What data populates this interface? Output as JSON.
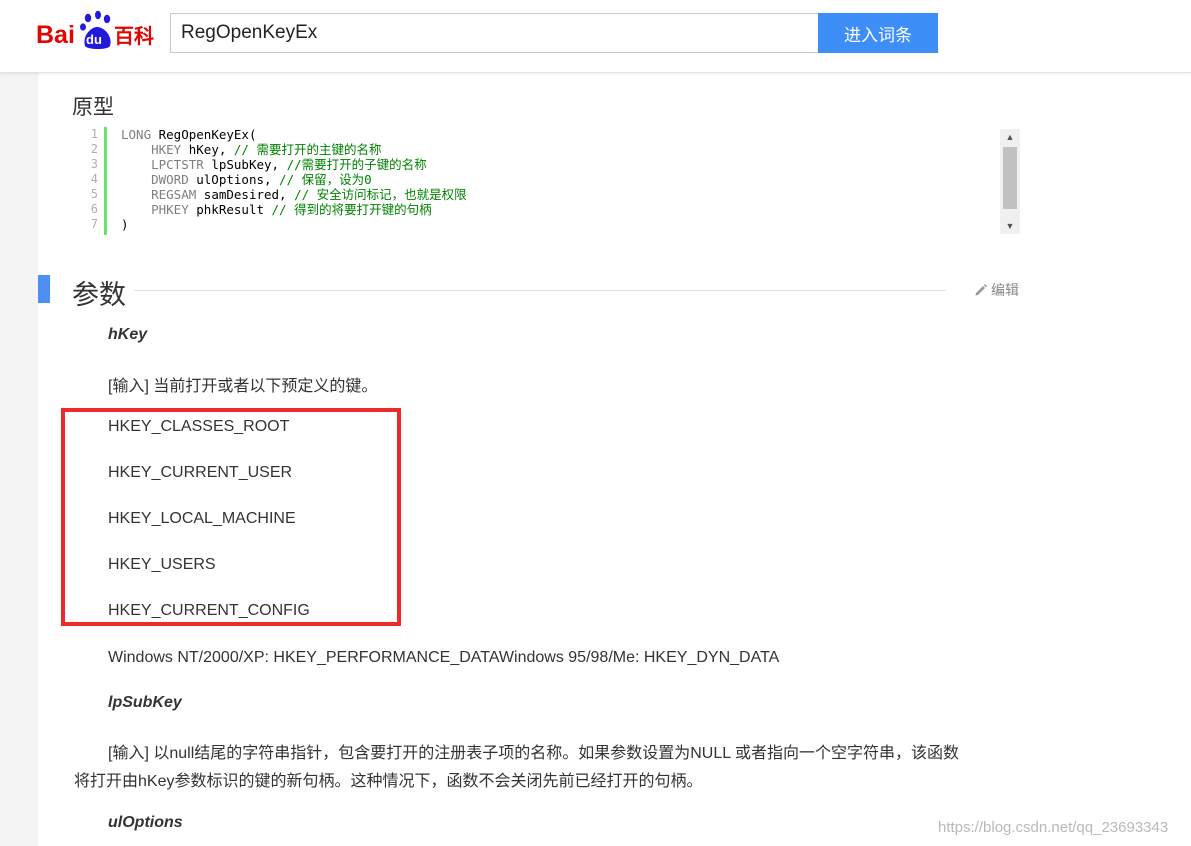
{
  "header": {
    "logo_text_left": "Bai",
    "logo_text_mid": "du",
    "logo_text_right": "百科",
    "search_value": "RegOpenKeyEx",
    "search_button": "进入词条"
  },
  "prototype": {
    "title": "原型",
    "line_numbers": [
      "1",
      "2",
      "3",
      "4",
      "5",
      "6",
      "7"
    ],
    "code_lines": [
      [
        {
          "t": "LONG",
          "c": "kw"
        },
        {
          "t": " RegOpenKeyEx(",
          "c": ""
        }
      ],
      [
        {
          "t": "    HKEY",
          "c": "kw"
        },
        {
          "t": " hKey, ",
          "c": ""
        },
        {
          "t": "// 需要打开的主键的名称",
          "c": "cm"
        }
      ],
      [
        {
          "t": "    LPCTSTR",
          "c": "kw"
        },
        {
          "t": " lpSubKey, ",
          "c": ""
        },
        {
          "t": "//需要打开的子键的名称",
          "c": "cm"
        }
      ],
      [
        {
          "t": "    DWORD",
          "c": "kw"
        },
        {
          "t": " ulOptions, ",
          "c": ""
        },
        {
          "t": "// 保留，设为0",
          "c": "cm"
        }
      ],
      [
        {
          "t": "    REGSAM",
          "c": "kw"
        },
        {
          "t": " samDesired, ",
          "c": ""
        },
        {
          "t": "// 安全访问标记，也就是权限",
          "c": "cm"
        }
      ],
      [
        {
          "t": "    PHKEY",
          "c": "kw"
        },
        {
          "t": " phkResult ",
          "c": ""
        },
        {
          "t": "// 得到的将要打开键的句柄",
          "c": "cm"
        }
      ],
      [
        {
          "t": ")",
          "c": ""
        }
      ]
    ]
  },
  "section": {
    "title": "参数",
    "edit_label": "编辑"
  },
  "params": {
    "hkey_name": "hKey",
    "hkey_desc": "[输入] 当前打开或者以下预定义的键。",
    "predefined": [
      "HKEY_CLASSES_ROOT",
      "HKEY_CURRENT_USER",
      "HKEY_LOCAL_MACHINE",
      "HKEY_USERS",
      "HKEY_CURRENT_CONFIG"
    ],
    "windows_note": "Windows NT/2000/XP: HKEY_PERFORMANCE_DATAWindows 95/98/Me: HKEY_DYN_DATA",
    "lpsubkey_name": "lpSubKey",
    "lpsubkey_desc_1": "[输入] 以null结尾的字符串指针，包含要打开的注册表子项的名称。如果参数设置为NULL 或者指向一个空字符串，该函数",
    "lpsubkey_desc_2": "将打开由hKey参数标识的键的新句柄。这种情况下，函数不会关闭先前已经打开的句柄。",
    "uloptions_name": "ulOptions"
  },
  "watermark": "https://blog.csdn.net/qq_23693343",
  "colors": {
    "accent": "#3e8ef7",
    "highlight": "#ee2b2b",
    "comment": "#008200",
    "gutter_line": "#6ce26c"
  }
}
